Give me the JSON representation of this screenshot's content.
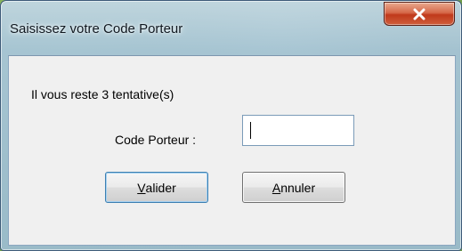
{
  "window": {
    "title": "Saisissez votre Code Porteur"
  },
  "message": {
    "remaining_attempts": "Il vous reste 3 tentative(s)"
  },
  "code_field": {
    "label": "Code Porteur :",
    "value": ""
  },
  "buttons": {
    "validate": {
      "mnemonic": "V",
      "rest": "alider"
    },
    "cancel": {
      "mnemonic": "A",
      "rest": "nnuler"
    }
  },
  "icons": {
    "close": "close-icon"
  },
  "colors": {
    "close_button": "#c0391b",
    "client_background": "#f0f0f0"
  }
}
